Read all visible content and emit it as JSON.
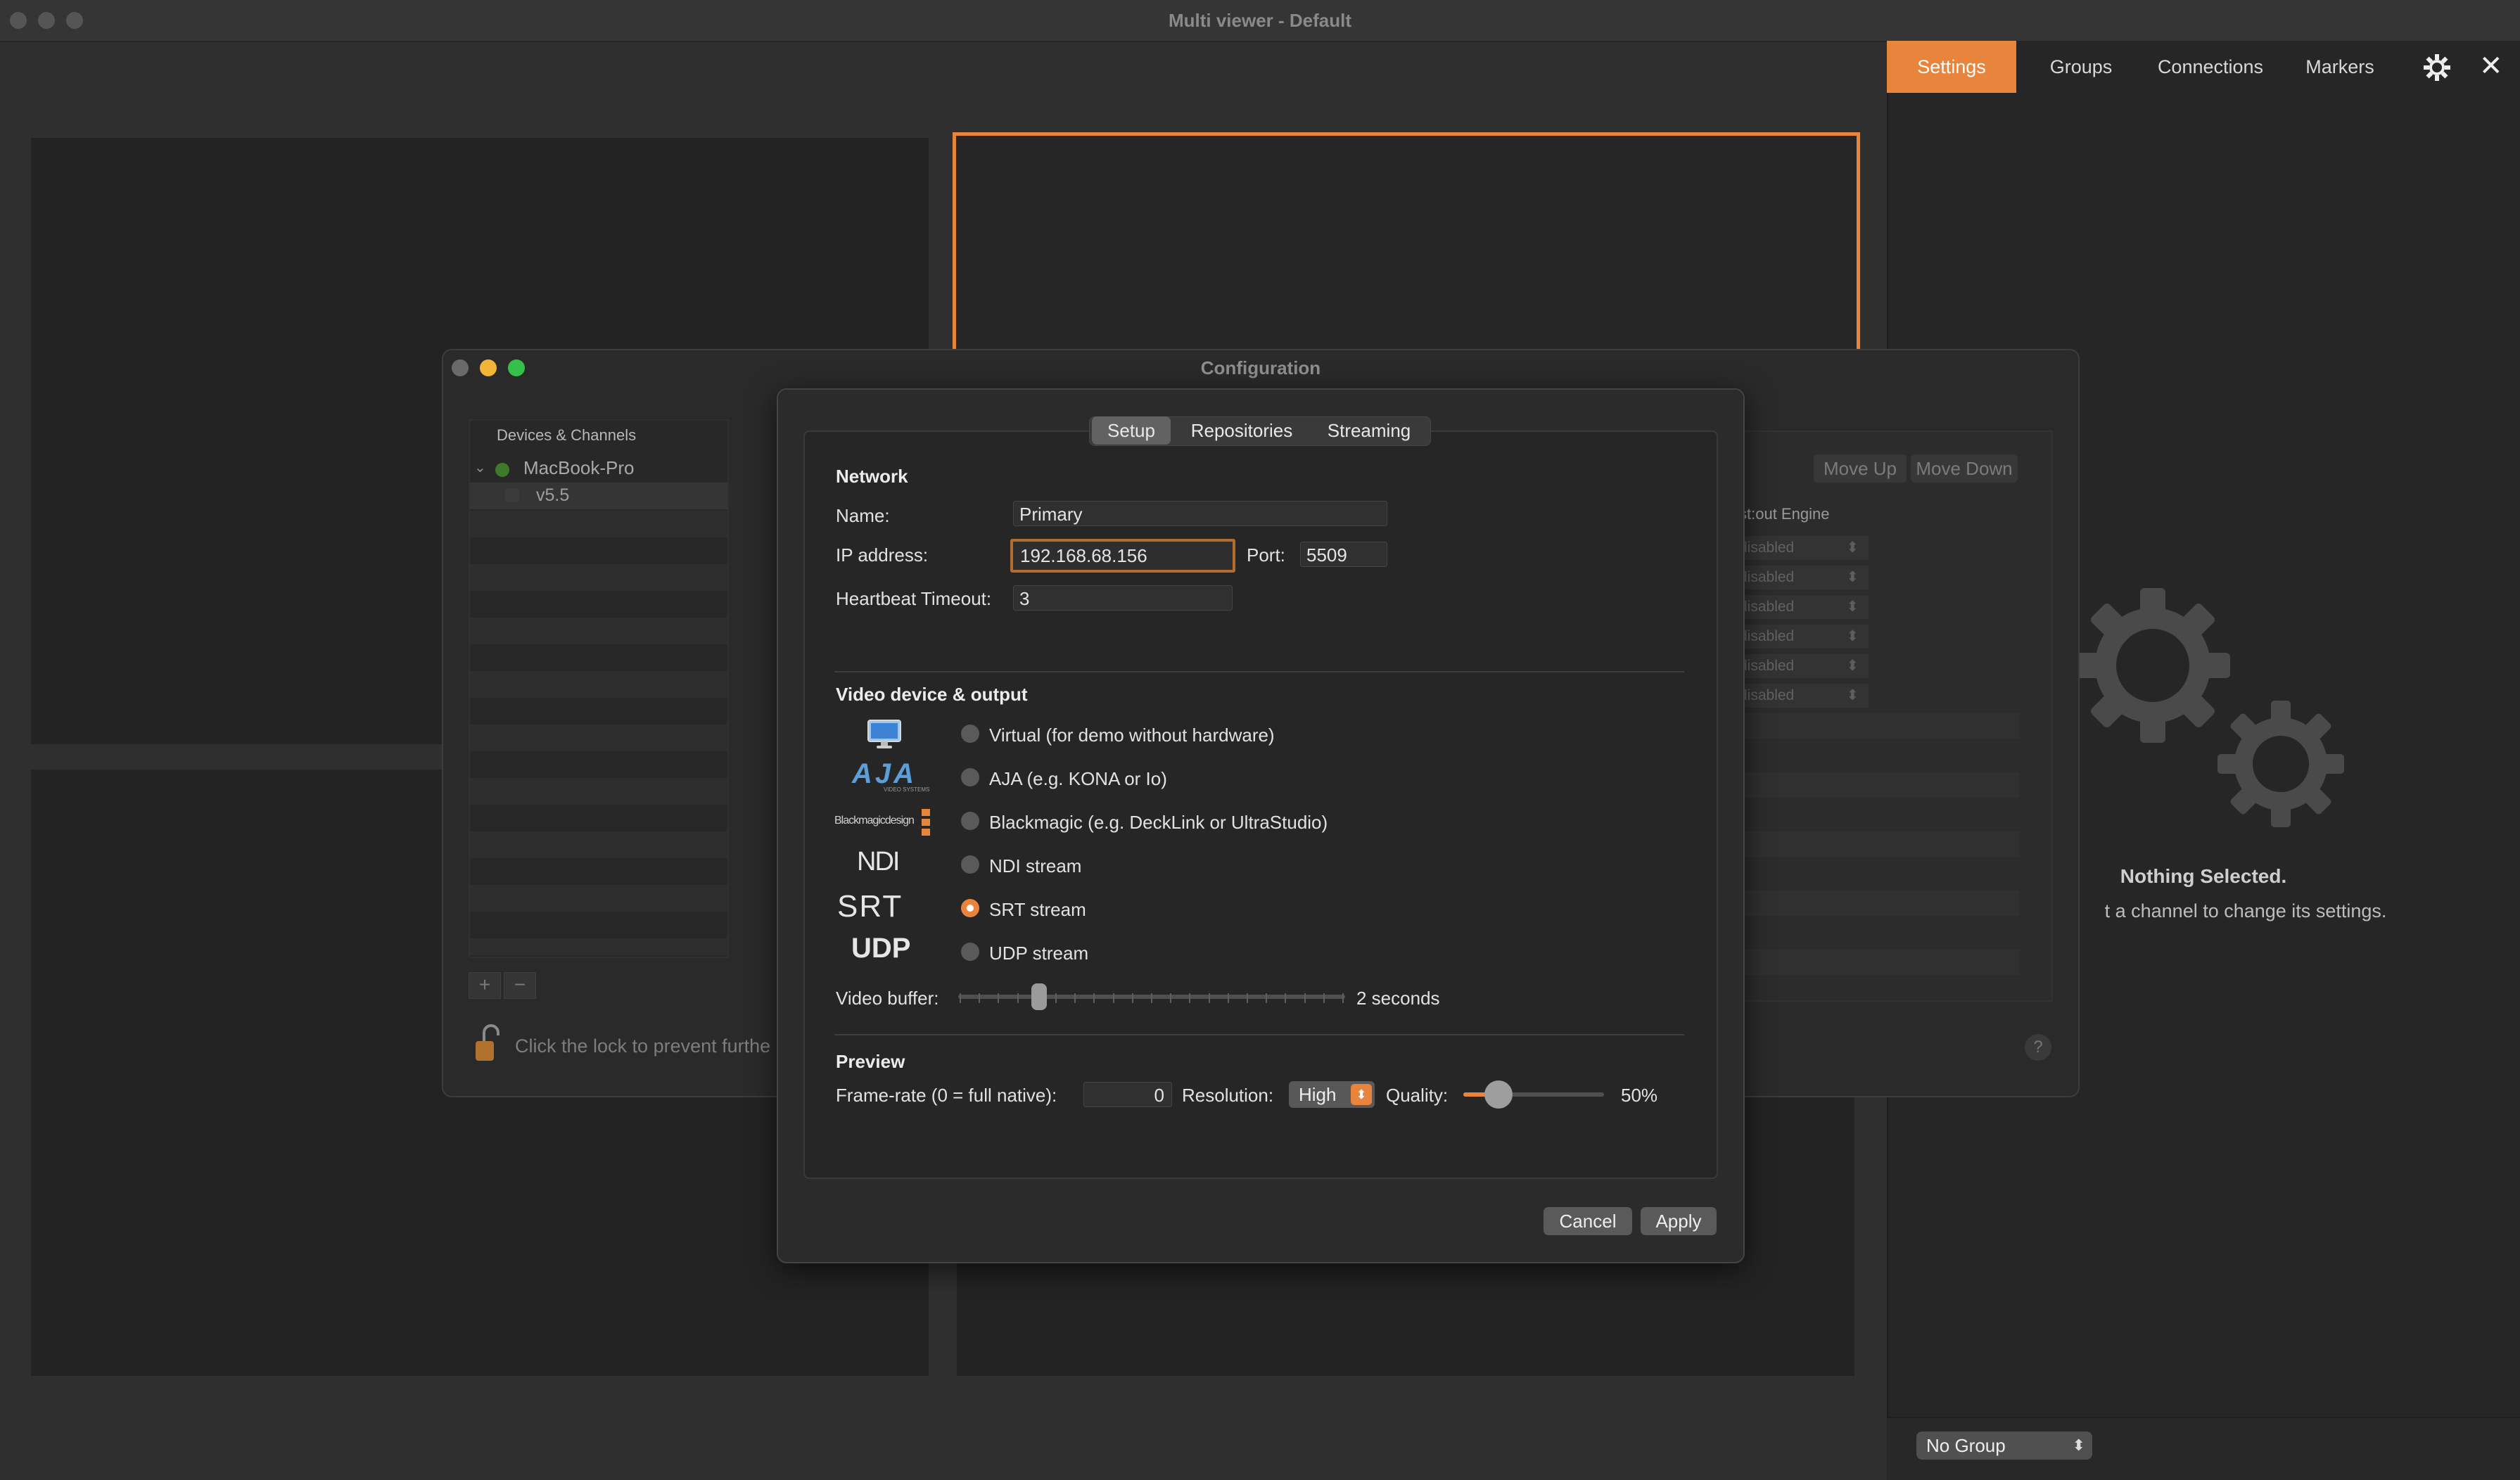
{
  "window": {
    "title": "Multi viewer - Default"
  },
  "inspector": {
    "tabs": [
      {
        "label": "Settings"
      },
      {
        "label": "Groups"
      },
      {
        "label": "Connections"
      },
      {
        "label": "Markers"
      }
    ],
    "empty_title": "Nothing Selected.",
    "empty_subtitle": "t a channel to change its settings.",
    "group_select": "No Group"
  },
  "config": {
    "title": "Configuration",
    "devices_header": "Devices & Channels",
    "device": "MacBook-Pro",
    "channel": "v5.5",
    "add": "+",
    "remove": "−",
    "lock_text": "Click the lock to prevent furthe",
    "move_up": "Move Up",
    "move_down": "Move Down",
    "engine_column": "st:out Engine",
    "engine_rows": [
      "disabled",
      "disabled",
      "disabled",
      "disabled",
      "disabled",
      "disabled"
    ],
    "help": "?"
  },
  "sheet": {
    "tabs": [
      "Setup",
      "Repositories",
      "Streaming"
    ],
    "network": {
      "title": "Network",
      "name_label": "Name:",
      "name_value": "Primary",
      "ip_label": "IP address:",
      "ip_value": "192.168.68.156",
      "port_label": "Port:",
      "port_value": "5509",
      "heartbeat_label": "Heartbeat Timeout:",
      "heartbeat_value": "3"
    },
    "video": {
      "title": "Video device & output",
      "options": [
        {
          "label": "Virtual (for demo without hardware)",
          "selected": false
        },
        {
          "label": "AJA (e.g. KONA or Io)",
          "selected": false
        },
        {
          "label": "Blackmagic (e.g. DeckLink or UltraStudio)",
          "selected": false
        },
        {
          "label": "NDI stream",
          "selected": false
        },
        {
          "label": "SRT stream",
          "selected": true
        },
        {
          "label": "UDP stream",
          "selected": false
        }
      ],
      "logos": {
        "aja": "AJA",
        "aja_sub": "VIDEO SYSTEMS",
        "blackmagic": "Blackmagicdesign",
        "ndi": "NDI",
        "srt": "SRT",
        "udp": "UDP"
      },
      "buffer_label": "Video buffer:",
      "buffer_value": "2 seconds",
      "buffer_seconds": 2
    },
    "preview": {
      "title": "Preview",
      "framerate_label": "Frame-rate (0 = full native):",
      "framerate_value": "0",
      "resolution_label": "Resolution:",
      "resolution_value": "High",
      "quality_label": "Quality:",
      "quality_value": "50%",
      "quality_fraction": 0.5
    },
    "cancel": "Cancel",
    "apply": "Apply"
  },
  "colors": {
    "accent": "#e8843c",
    "background": "#2f2f2f"
  }
}
